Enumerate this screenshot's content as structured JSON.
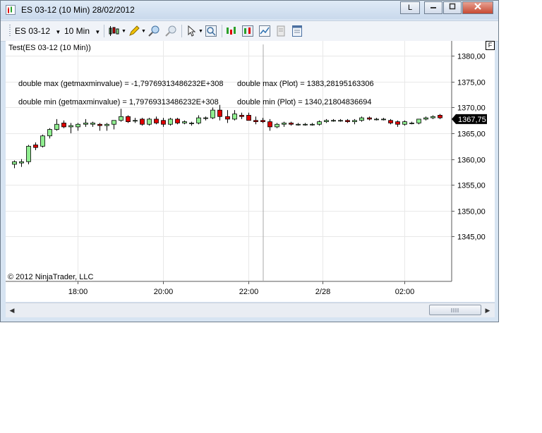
{
  "window": {
    "title": "ES 03-12 (10 Min)  28/02/2012",
    "link_button": "L"
  },
  "toolbar": {
    "instrument": "ES 03-12",
    "interval": "10 Min"
  },
  "chart": {
    "indicator_label": "Test(ES 03-12 (10 Min))",
    "panel_button": "F",
    "copyright": "© 2012 NinjaTrader, LLC",
    "last_price_label": "1367,75",
    "annotations": {
      "max_getmaxmin": "double max (getmaxminvalue) = -1,79769313486232E+308",
      "max_plot": "double max (Plot) = 1383,28195163306",
      "min_getmaxmin": "double min (getmaxminvalue) = 1,79769313486232E+308",
      "min_plot": "double min (Plot) = 1340,21804836694"
    },
    "colors": {
      "up": "#90ee90",
      "down": "#e00000",
      "outline": "#000000",
      "price_tag": "#000000"
    }
  },
  "chart_data": {
    "type": "candlestick",
    "title": "Test(ES 03-12 (10 Min))",
    "y_ticks": [
      "1380,00",
      "1375,00",
      "1370,00",
      "1365,00",
      "1360,00",
      "1355,00",
      "1350,00",
      "1345,00"
    ],
    "y_tick_values": [
      1380,
      1375,
      1370,
      1365,
      1360,
      1355,
      1350,
      1345
    ],
    "x_ticks": [
      "18:00",
      "20:00",
      "22:00",
      "2/28",
      "02:00"
    ],
    "ylim": [
      1341.5,
      1382.5
    ],
    "grid": true,
    "candles": [
      {
        "o": 1359.0,
        "h": 1359.75,
        "l": 1358.25,
        "c": 1359.5
      },
      {
        "o": 1359.25,
        "h": 1360.0,
        "l": 1358.5,
        "c": 1359.5
      },
      {
        "o": 1359.5,
        "h": 1362.75,
        "l": 1359.0,
        "c": 1362.5
      },
      {
        "o": 1362.75,
        "h": 1363.25,
        "l": 1361.75,
        "c": 1362.25
      },
      {
        "o": 1362.5,
        "h": 1364.75,
        "l": 1362.25,
        "c": 1364.5
      },
      {
        "o": 1364.5,
        "h": 1366.0,
        "l": 1364.0,
        "c": 1365.75
      },
      {
        "o": 1365.75,
        "h": 1367.75,
        "l": 1365.5,
        "c": 1366.75
      },
      {
        "o": 1367.0,
        "h": 1367.5,
        "l": 1366.0,
        "c": 1366.25
      },
      {
        "o": 1366.25,
        "h": 1367.0,
        "l": 1365.0,
        "c": 1366.5
      },
      {
        "o": 1366.25,
        "h": 1367.0,
        "l": 1365.5,
        "c": 1366.75
      },
      {
        "o": 1366.75,
        "h": 1367.75,
        "l": 1366.25,
        "c": 1367.0
      },
      {
        "o": 1366.75,
        "h": 1367.25,
        "l": 1366.25,
        "c": 1367.0
      },
      {
        "o": 1366.75,
        "h": 1367.0,
        "l": 1365.5,
        "c": 1366.5
      },
      {
        "o": 1366.5,
        "h": 1367.0,
        "l": 1365.5,
        "c": 1366.75
      },
      {
        "o": 1366.75,
        "h": 1367.5,
        "l": 1365.75,
        "c": 1367.5
      },
      {
        "o": 1367.5,
        "h": 1369.75,
        "l": 1367.25,
        "c": 1368.25
      },
      {
        "o": 1368.25,
        "h": 1368.5,
        "l": 1367.0,
        "c": 1367.25
      },
      {
        "o": 1367.5,
        "h": 1368.0,
        "l": 1367.0,
        "c": 1367.5
      },
      {
        "o": 1367.75,
        "h": 1368.0,
        "l": 1366.5,
        "c": 1366.75
      },
      {
        "o": 1366.75,
        "h": 1368.0,
        "l": 1366.5,
        "c": 1367.75
      },
      {
        "o": 1367.75,
        "h": 1368.25,
        "l": 1366.75,
        "c": 1367.0
      },
      {
        "o": 1367.5,
        "h": 1368.0,
        "l": 1366.25,
        "c": 1366.75
      },
      {
        "o": 1366.75,
        "h": 1368.0,
        "l": 1366.5,
        "c": 1367.75
      },
      {
        "o": 1367.75,
        "h": 1368.0,
        "l": 1366.75,
        "c": 1367.0
      },
      {
        "o": 1367.0,
        "h": 1367.5,
        "l": 1366.75,
        "c": 1367.25
      },
      {
        "o": 1367.0,
        "h": 1367.25,
        "l": 1366.5,
        "c": 1367.0
      },
      {
        "o": 1367.0,
        "h": 1368.5,
        "l": 1366.75,
        "c": 1368.0
      },
      {
        "o": 1368.0,
        "h": 1368.25,
        "l": 1367.5,
        "c": 1368.0
      },
      {
        "o": 1368.0,
        "h": 1370.0,
        "l": 1367.75,
        "c": 1369.5
      },
      {
        "o": 1369.5,
        "h": 1370.5,
        "l": 1367.5,
        "c": 1368.25
      },
      {
        "o": 1368.25,
        "h": 1369.5,
        "l": 1367.0,
        "c": 1367.75
      },
      {
        "o": 1367.75,
        "h": 1369.5,
        "l": 1367.5,
        "c": 1368.75
      },
      {
        "o": 1368.5,
        "h": 1369.0,
        "l": 1367.75,
        "c": 1368.25
      },
      {
        "o": 1368.5,
        "h": 1369.0,
        "l": 1367.5,
        "c": 1367.5
      },
      {
        "o": 1367.5,
        "h": 1368.25,
        "l": 1366.75,
        "c": 1367.25
      },
      {
        "o": 1367.5,
        "h": 1368.0,
        "l": 1367.0,
        "c": 1367.25
      },
      {
        "o": 1367.25,
        "h": 1367.75,
        "l": 1365.5,
        "c": 1366.25
      },
      {
        "o": 1366.25,
        "h": 1367.0,
        "l": 1366.0,
        "c": 1366.75
      },
      {
        "o": 1366.75,
        "h": 1367.25,
        "l": 1366.25,
        "c": 1367.0
      },
      {
        "o": 1367.0,
        "h": 1367.25,
        "l": 1366.5,
        "c": 1366.75
      },
      {
        "o": 1366.75,
        "h": 1367.0,
        "l": 1366.5,
        "c": 1366.75
      },
      {
        "o": 1366.75,
        "h": 1367.0,
        "l": 1366.5,
        "c": 1366.75
      },
      {
        "o": 1366.75,
        "h": 1367.0,
        "l": 1366.5,
        "c": 1366.75
      },
      {
        "o": 1366.75,
        "h": 1367.5,
        "l": 1366.5,
        "c": 1367.25
      },
      {
        "o": 1367.25,
        "h": 1367.75,
        "l": 1367.0,
        "c": 1367.5
      },
      {
        "o": 1367.5,
        "h": 1367.75,
        "l": 1367.25,
        "c": 1367.5
      },
      {
        "o": 1367.5,
        "h": 1367.75,
        "l": 1367.25,
        "c": 1367.5
      },
      {
        "o": 1367.5,
        "h": 1367.75,
        "l": 1367.0,
        "c": 1367.25
      },
      {
        "o": 1367.25,
        "h": 1367.75,
        "l": 1366.75,
        "c": 1367.5
      },
      {
        "o": 1367.5,
        "h": 1368.25,
        "l": 1367.25,
        "c": 1368.0
      },
      {
        "o": 1368.0,
        "h": 1368.25,
        "l": 1367.5,
        "c": 1367.75
      },
      {
        "o": 1367.75,
        "h": 1368.0,
        "l": 1367.5,
        "c": 1367.75
      },
      {
        "o": 1367.75,
        "h": 1368.0,
        "l": 1367.5,
        "c": 1367.75
      },
      {
        "o": 1367.5,
        "h": 1367.75,
        "l": 1366.75,
        "c": 1367.0
      },
      {
        "o": 1367.25,
        "h": 1367.5,
        "l": 1366.25,
        "c": 1366.75
      },
      {
        "o": 1366.75,
        "h": 1367.5,
        "l": 1366.5,
        "c": 1367.25
      },
      {
        "o": 1367.0,
        "h": 1367.25,
        "l": 1366.75,
        "c": 1367.0
      },
      {
        "o": 1367.0,
        "h": 1367.75,
        "l": 1366.75,
        "c": 1367.75
      },
      {
        "o": 1367.75,
        "h": 1368.25,
        "l": 1367.5,
        "c": 1368.0
      },
      {
        "o": 1368.0,
        "h": 1368.5,
        "l": 1367.75,
        "c": 1368.25
      },
      {
        "o": 1368.5,
        "h": 1368.75,
        "l": 1367.75,
        "c": 1368.0
      }
    ]
  }
}
